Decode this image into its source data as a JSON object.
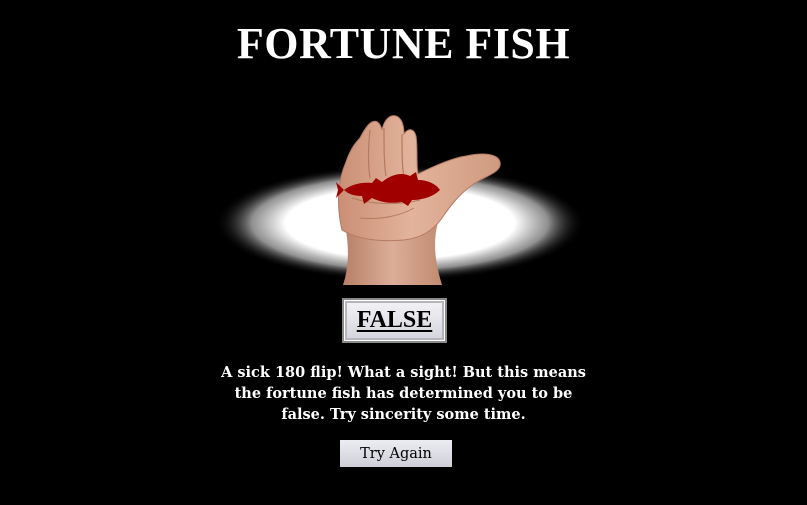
{
  "header": {
    "title": "FORTUNE FISH"
  },
  "result": {
    "label": "FALSE"
  },
  "message": {
    "text": "A sick 180 flip! What a sight! But this means the fortune fish has determined you to be false. Try sincerity some time."
  },
  "actions": {
    "try_again_label": "Try Again"
  },
  "colors": {
    "background": "#000000",
    "fish": "#a00000",
    "glow": "#ffffff",
    "skin": "#d9a58a",
    "button_light": "#ececf2",
    "button_dark": "#cfcfd8"
  },
  "icons": {
    "fish": "fish-icon",
    "hand": "hand-image"
  }
}
